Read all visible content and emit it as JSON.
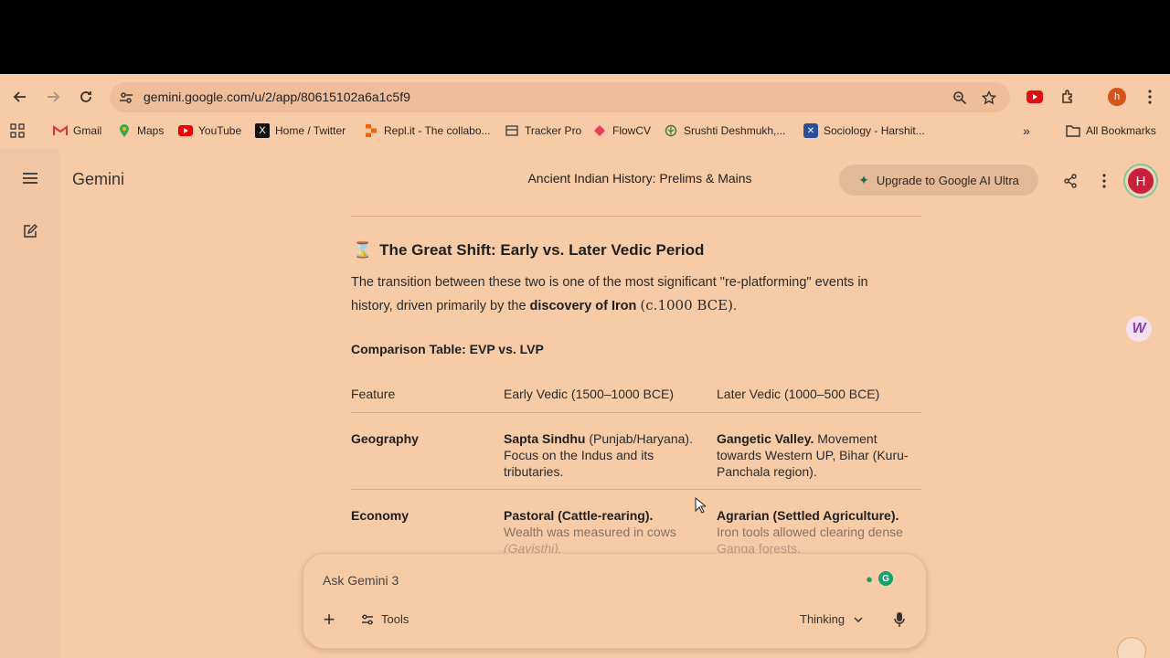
{
  "browser": {
    "url": "gemini.google.com/u/2/app/80615102a6a1c5f9",
    "profile_initial": "h",
    "bookmarks": [
      {
        "label": "Gmail",
        "icon": "gmail-icon"
      },
      {
        "label": "Maps",
        "icon": "maps-icon"
      },
      {
        "label": "YouTube",
        "icon": "youtube-icon"
      },
      {
        "label": "Home / Twitter",
        "icon": "x-icon"
      },
      {
        "label": "Repl.it - The collabo...",
        "icon": "replit-icon"
      },
      {
        "label": "Tracker Pro",
        "icon": "tracker-icon"
      },
      {
        "label": "FlowCV",
        "icon": "flowcv-icon"
      },
      {
        "label": "Srushti Deshmukh,...",
        "icon": "leaf-icon"
      },
      {
        "label": "Sociology - Harshit...",
        "icon": "sociology-icon"
      }
    ],
    "all_bookmarks": "All Bookmarks",
    "overflow": "»"
  },
  "gemini": {
    "logo": "Gemini",
    "chat_title": "Ancient Indian History: Prelims & Mains",
    "upgrade_label": "Upgrade to Google AI Ultra",
    "avatar_initial": "H"
  },
  "content": {
    "section_icon": "⌛",
    "section_title": "The Great Shift: Early vs. Later Vedic Period",
    "para_part1": "The transition between these two is one of the most significant \"re-platforming\" events in history, driven primarily by the ",
    "para_bold": "discovery of Iron",
    "para_math": "(c.1000 BCE)",
    "para_end": ".",
    "table_heading": "Comparison Table: EVP vs. LVP",
    "table": {
      "headers": [
        "Feature",
        "Early Vedic (1500–1000 BCE)",
        "Later Vedic (1000–500 BCE)"
      ],
      "geography": {
        "feature": "Geography",
        "early_bold": "Sapta Sindhu",
        "early_rest": " (Punjab/Haryana). Focus on the Indus and its tributaries.",
        "later_bold": "Gangetic Valley.",
        "later_rest": " Movement towards Western UP, Bihar (Kuru-Panchala region)."
      },
      "economy": {
        "feature": "Economy",
        "early_bold": "Pastoral (Cattle-rearing).",
        "early_line2": "Wealth was measured in cows",
        "early_line3": "(Gavisthi).",
        "later_bold": "Agrarian (Settled Agriculture).",
        "later_line2": "Iron tools allowed clearing dense",
        "later_line3": "Ganga forests."
      }
    }
  },
  "input": {
    "placeholder": "Ask Gemini 3",
    "tools_label": "Tools",
    "mode_label": "Thinking"
  }
}
